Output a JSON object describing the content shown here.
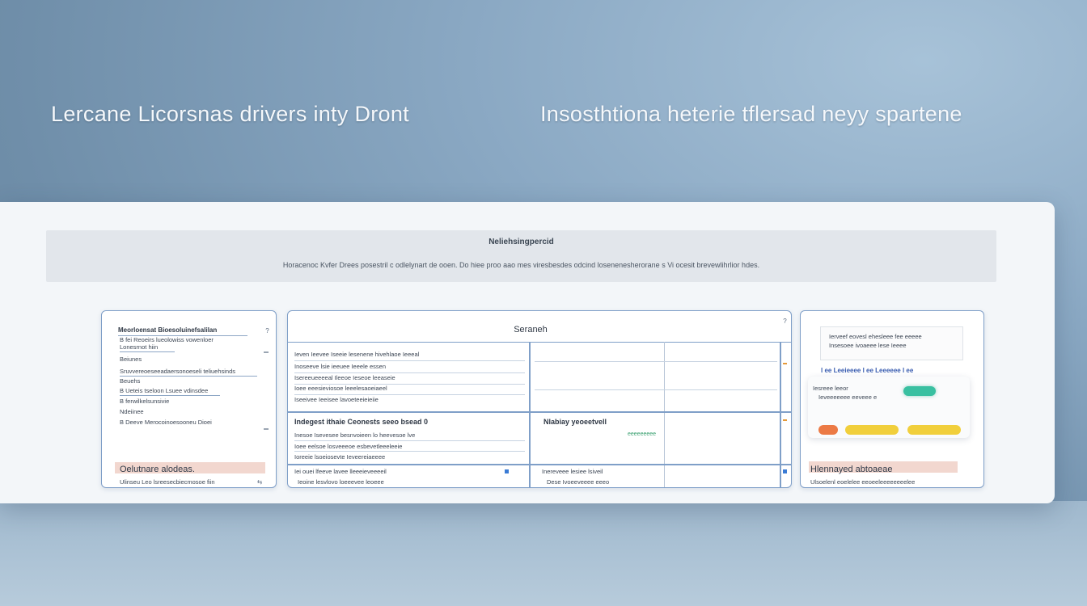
{
  "headline": {
    "left": "Lercane Licorsnas drivers inty Dront",
    "right": "Insosthtiona heterie tflersad neyy spartene"
  },
  "banner": {
    "title": "Neliehsingpercid",
    "subtitle": "Horacenoc Kvfer Drees posestril c odlelynart de ooen. Do hiee proo aao mes viresbesdes odcind losenenesherorane s Vi ocesit brevewlihrlior hdes."
  },
  "left_card": {
    "heading": "Meorloensat Bioesoluinefsalilan",
    "lines": [
      "B fei  Reoeirs lueolowiss vowenloer",
      "Lonesrnot hiin",
      "Beiunes",
      "Sruvvereoeseeadaersonoeseli teliuehsinds",
      "Beuehs",
      "B Ueteis tseloon Lsuee vdinsdee",
      "B ferwilkelsunsivie",
      "Ndeiinee",
      "B  Deeve Merocoinoesooneu Dioei"
    ],
    "footer_title": "Oelutnare alodeas.",
    "footer_sub": "Ulinseu Leo lsreesecbiecmosoe fiin"
  },
  "mid_card": {
    "title": "Seraneh",
    "top_left_rows": [
      "Ieven Ieevee Iseeie lesenene hivehlaoe Ieeeal",
      "Inoseeve lsie ieeuee Ieeele essen",
      "Isereeueeeeal Ileeoe Ieseoe leeaseie",
      "Ioee eeesieviosoe leeelesaoeiaeel",
      "Iseeivee Ieeisee lavoeteeieieiie"
    ],
    "bottom_left_title": "Indegest ithaie Ceonests seeo bsead 0",
    "bottom_left_rows": [
      "Inesoe Isevesee besnvoieen lo heevesoe lve",
      "Ioee eelsoe losveeeoe esbevetleeeleeie",
      "Ioreeie lsoeiosevte Ieveereiaeeee"
    ],
    "right_title": "Nlabiay yeoeetvell",
    "green_label": "eeeeeeeee",
    "footer_left": "Iei ouei lfeeve lavee lleeeieveeeeil",
    "footer_left_sub": "Ieoine lesvlovo loeeevee leoeee",
    "footer_right": "Inereveee lesiee lsiveil",
    "footer_right_sub": "Dese Ivoeeveeee eeeo"
  },
  "right_card": {
    "box_lines": [
      "Ierveef eovesl ehesleee fee eeeee",
      "Insesoee ivoaeee lese Ieeee"
    ],
    "status_row": "l ee Leeieeee l ee   Leeeeee  l ee",
    "item_label": "Iesreee leeor",
    "item_sub": "Ieveeeeeee eeveee e",
    "footer_title": "Hlennayed abtoaeae",
    "footer_sub": "Ulsoelenl eoelelee eeoeeleeeeeeeelee"
  },
  "colors": {
    "accent_blue": "#7f9fc8",
    "toggle_green": "#39c0a1",
    "pill_orange": "#ec7a45",
    "pill_yellow": "#f1cf3c"
  },
  "icons": [
    "help-icon",
    "scroll-handle-icon"
  ]
}
